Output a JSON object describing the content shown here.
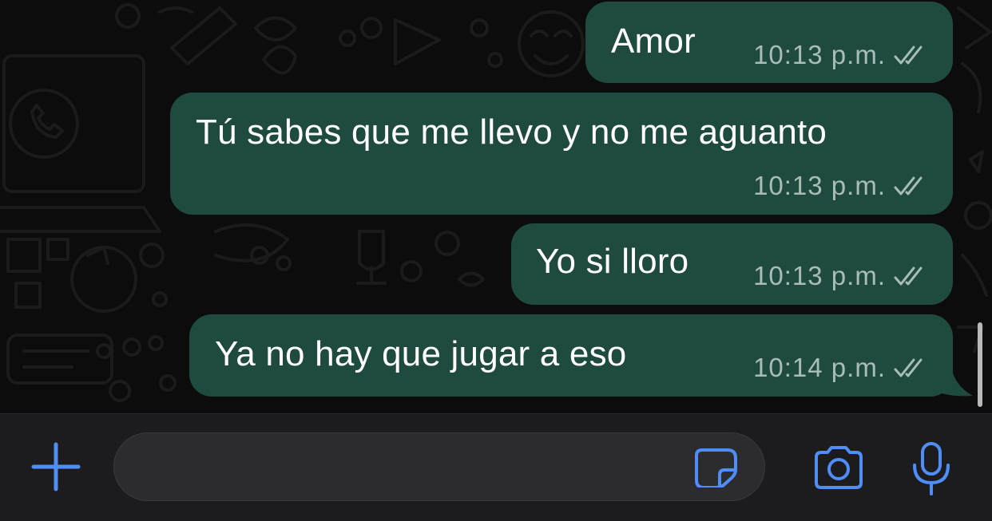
{
  "colors": {
    "accent": "#4f8ef7",
    "outgoing_bubble": "#1f4a40",
    "chat_background": "#0c0c0c",
    "input_bar": "#1c1c1e",
    "timestamp": "#a9bdb7"
  },
  "messages": [
    {
      "text": "Amor",
      "time": "10:13 p.m.",
      "status_icon": "double-check-icon"
    },
    {
      "text": "Tú sabes que me llevo y no me aguanto",
      "time": "10:13 p.m.",
      "status_icon": "double-check-icon"
    },
    {
      "text": "Yo si lloro",
      "time": "10:13 p.m.",
      "status_icon": "double-check-icon"
    },
    {
      "text": "Ya no hay que jugar a eso",
      "time": "10:14 p.m.",
      "status_icon": "double-check-icon"
    }
  ],
  "composer": {
    "placeholder": "",
    "value": "",
    "icons": [
      "plus-icon",
      "sticker-icon",
      "camera-icon",
      "microphone-icon"
    ]
  }
}
